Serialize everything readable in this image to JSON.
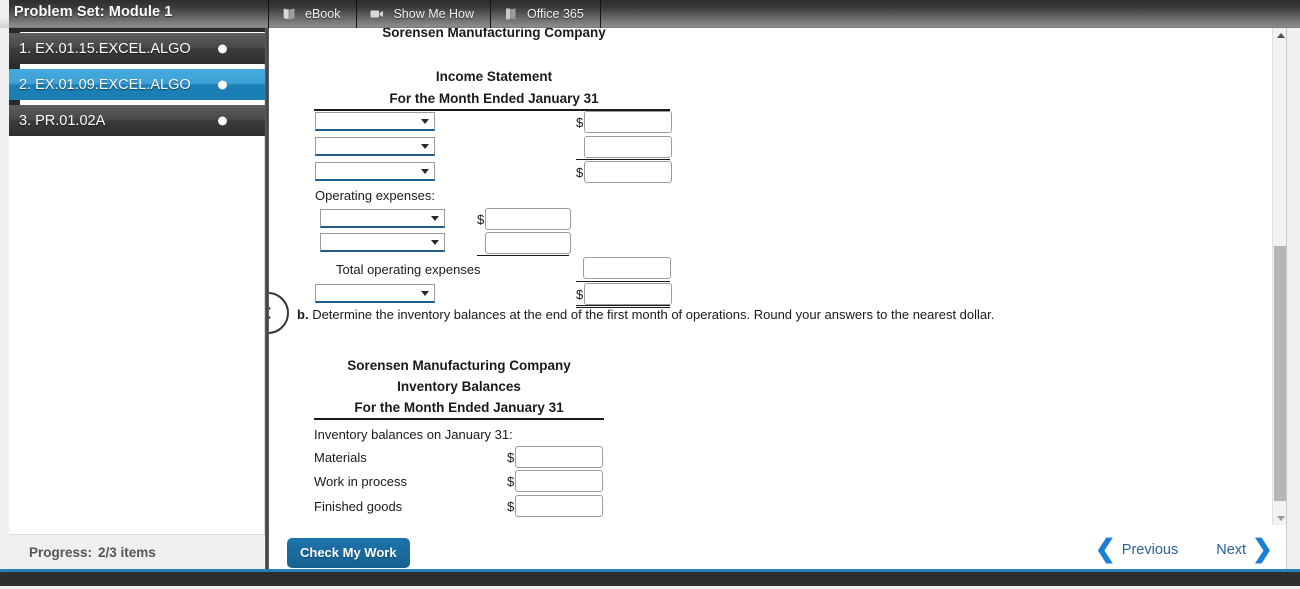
{
  "header": {
    "problem_set_title": "Problem Set: Module 1",
    "tabs": [
      {
        "label": "eBook",
        "icon": "book-icon"
      },
      {
        "label": "Show Me How",
        "icon": "video-camera-icon"
      },
      {
        "label": "Office 365",
        "icon": "office-door-icon"
      }
    ]
  },
  "sidebar": {
    "items": [
      {
        "label": "1. EX.01.15.EXCEL.ALGO",
        "selected": false,
        "status_dot": "complete-dot"
      },
      {
        "label": "2. EX.01.09.EXCEL.ALGO",
        "selected": true,
        "status_dot": "complete-dot"
      },
      {
        "label": "3. PR.01.02A",
        "selected": false,
        "status_dot": "complete-dot"
      }
    ],
    "progress_label": "Progress:",
    "progress_value": "2/3 items"
  },
  "content": {
    "collapse_icon": "chevron-left-icon",
    "income_statement": {
      "company": "Sorensen Manufacturing Company",
      "title": "Income Statement",
      "period": "For the Month Ended January 31",
      "rows": [
        {
          "type": "select",
          "value": "",
          "dollar": "$",
          "amount": ""
        },
        {
          "type": "select",
          "value": "",
          "dollar": "",
          "amount": ""
        },
        {
          "type": "select",
          "value": "",
          "dollar": "$",
          "amount": ""
        }
      ],
      "operating_expenses_label": "Operating expenses:",
      "expense_rows": [
        {
          "type": "select",
          "value": "",
          "dollar": "$",
          "amount": ""
        },
        {
          "type": "select",
          "value": "",
          "dollar": "",
          "amount": ""
        }
      ],
      "total_operating_expenses_label": "Total operating expenses",
      "total_operating_expenses_value": "",
      "final_row": {
        "type": "select",
        "value": "",
        "dollar": "$",
        "amount": ""
      }
    },
    "part_b": {
      "marker": "b.",
      "text": "Determine the inventory balances at the end of the first month of operations. Round your answers to the nearest dollar."
    },
    "inventory_statement": {
      "company": "Sorensen Manufacturing Company",
      "title": "Inventory Balances",
      "period": "For the Month Ended January 31",
      "subhead": "Inventory balances on January 31:",
      "rows": [
        {
          "label": "Materials",
          "dollar": "$",
          "amount": ""
        },
        {
          "label": "Work in process",
          "dollar": "$",
          "amount": ""
        },
        {
          "label": "Finished goods",
          "dollar": "$",
          "amount": ""
        }
      ]
    }
  },
  "footer": {
    "check_button": "Check My Work",
    "previous_label": "Previous",
    "next_label": "Next",
    "previous_icon": "chevron-left-icon",
    "next_icon": "chevron-right-icon"
  },
  "scrollbar": {
    "up_icon": "scroll-up-arrow-icon",
    "down_icon": "scroll-down-arrow-icon"
  },
  "colors": {
    "accent_blue": "#1b7fb5",
    "selected_item_blue": "#3ea2d8",
    "button_blue": "#17618f",
    "link_blue": "#2c5f9e",
    "footer_rule_blue": "#2980b9"
  }
}
